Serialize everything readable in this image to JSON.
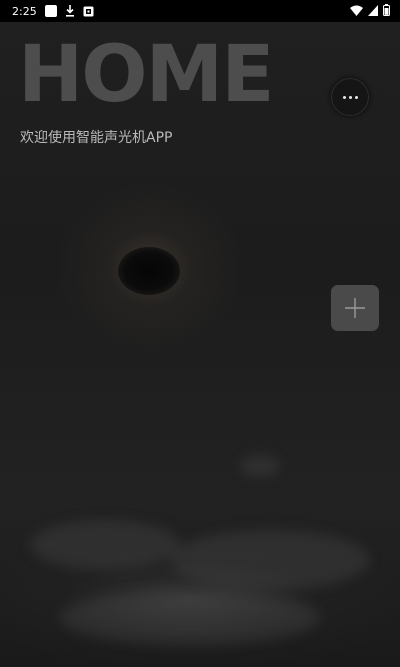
{
  "status_bar": {
    "time": "2:25",
    "left_icons": [
      "app-icon",
      "download-icon",
      "photo-icon"
    ],
    "right_icons": [
      "wifi-icon",
      "signal-icon",
      "battery-icon"
    ]
  },
  "header": {
    "title": "HOME",
    "subtitle": "欢迎使用智能声光机APP"
  },
  "actions": {
    "more_icon": "more-dots-icon",
    "add_icon": "plus-icon"
  },
  "colors": {
    "background": "#1b1b1b",
    "title": "#4d4d4d",
    "subtitle": "#b9b9b9",
    "add_button": "#4a4a4a"
  }
}
